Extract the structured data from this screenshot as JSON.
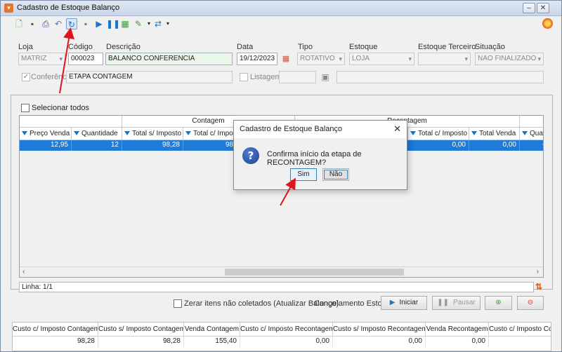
{
  "window": {
    "title": "Cadastro de Estoque Balanço"
  },
  "form": {
    "loja": {
      "label": "Loja",
      "value": "MATRIZ"
    },
    "codigo": {
      "label": "Código",
      "value": "000023"
    },
    "descricao": {
      "label": "Descrição",
      "value": "BALANCO CONFERENCIA"
    },
    "data": {
      "label": "Data",
      "value": "19/12/2023"
    },
    "tipo": {
      "label": "Tipo",
      "value": "ROTATIVO"
    },
    "estoque": {
      "label": "Estoque",
      "value": "LOJA"
    },
    "estoque_terceiro": {
      "label": "Estoque Terceiro",
      "value": ""
    },
    "situacao": {
      "label": "Situação",
      "value": "NAO FINALIZADO"
    },
    "conferencia": {
      "label": "Conferência",
      "value": "ETAPA CONTAGEM",
      "checked": true
    },
    "listagem": {
      "label": "Listagem",
      "value": ""
    }
  },
  "grid": {
    "select_all_label": "Selecionar todos",
    "groups": [
      "Contagem",
      "Recontagem"
    ],
    "columns": [
      "Preço Venda",
      "Quantidade",
      "Total s/ Imposto",
      "Total c/ Imposto",
      "Total c/ Imposto",
      "Total Venda",
      "Quan"
    ],
    "row": [
      "12,95",
      "12",
      "98,28",
      "98,28",
      "0,00",
      "0,00",
      "-"
    ]
  },
  "status": {
    "linha": "Linha: 1/1"
  },
  "actions": {
    "zerar_label": "Zerar itens não coletados (Atualizar Balanço)",
    "congelamento_label": "Congelamento Estoque",
    "iniciar": "Iniciar",
    "pausar": "Pausar"
  },
  "totals": {
    "headers": [
      "Custo c/ Imposto Contagem",
      "Custo s/ Imposto Contagem",
      "Venda Contagem",
      "Custo c/ Imposto Recontagem",
      "Custo s/ Imposto Recontagem",
      "Venda Recontagem",
      "Custo c/ Imposto Con"
    ],
    "values": [
      "98,28",
      "98,28",
      "155,40",
      "0,00",
      "0,00",
      "0,00",
      ""
    ]
  },
  "dialog": {
    "title": "Cadastro de Estoque Balanço",
    "message": "Confirma início da etapa de RECONTAGEM?",
    "yes": "Sim",
    "no": "Não"
  },
  "colors": {
    "selection": "#1e7bd7",
    "annotation_arrow": "#e0141e",
    "icon_blue": "#1677c9"
  }
}
